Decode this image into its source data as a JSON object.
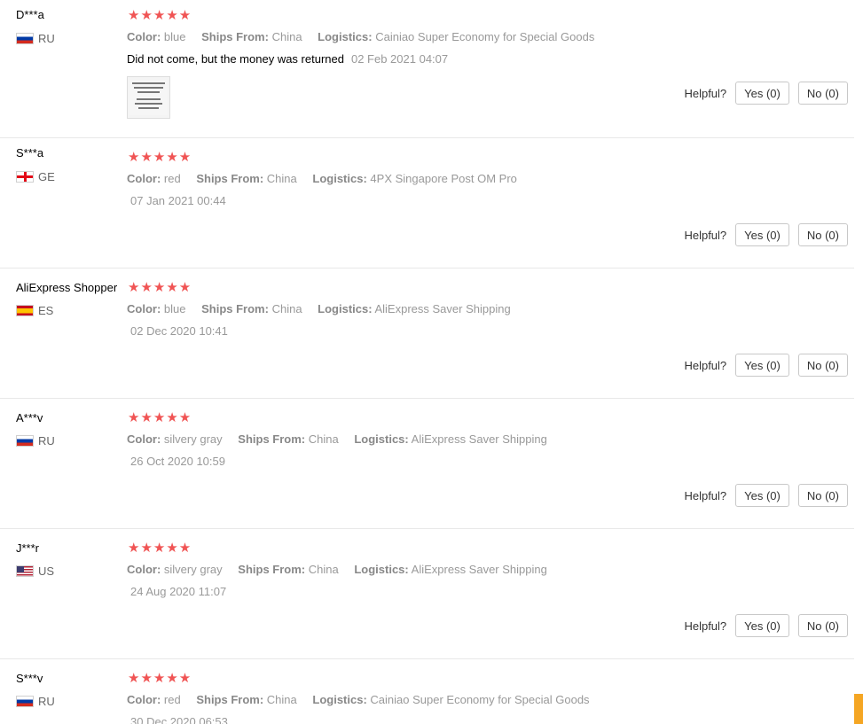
{
  "labels": {
    "color": "Color:",
    "ships_from": "Ships From:",
    "logistics": "Logistics:",
    "helpful": "Helpful?"
  },
  "star_color": "#f05454",
  "reviews": [
    {
      "user": "D***a",
      "country": "RU",
      "flag_icon": "flag-ru-icon",
      "rating": 5,
      "color": "blue",
      "ships_from": "China",
      "logistics": "Cainiao Super Economy for Special Goods",
      "text": "Did not come, but the money was returned",
      "date": "02 Feb 2021 04:07",
      "has_photo": true,
      "yes_label": "Yes (0)",
      "no_label": "No (0)"
    },
    {
      "user": "S***a",
      "country": "GE",
      "flag_icon": "flag-ge-icon",
      "rating": 5,
      "color": "red",
      "ships_from": "China",
      "logistics": "4PX Singapore Post OM Pro",
      "text": "",
      "date": "07 Jan 2021 00:44",
      "yes_label": "Yes (0)",
      "no_label": "No (0)"
    },
    {
      "user": "AliExpress Shopper",
      "country": "ES",
      "flag_icon": "flag-es-icon",
      "rating": 5,
      "color": "blue",
      "ships_from": "China",
      "logistics": "AliExpress Saver Shipping",
      "text": "",
      "date": "02 Dec 2020 10:41",
      "yes_label": "Yes (0)",
      "no_label": "No (0)"
    },
    {
      "user": "A***v",
      "country": "RU",
      "flag_icon": "flag-ru-icon",
      "rating": 5,
      "color": "silvery gray",
      "ships_from": "China",
      "logistics": "AliExpress Saver Shipping",
      "text": "",
      "date": "26 Oct 2020 10:59",
      "yes_label": "Yes (0)",
      "no_label": "No (0)"
    },
    {
      "user": "J***r",
      "country": "US",
      "flag_icon": "flag-us-icon",
      "rating": 5,
      "color": "silvery gray",
      "ships_from": "China",
      "logistics": "AliExpress Saver Shipping",
      "text": "",
      "date": "24 Aug 2020 11:07",
      "yes_label": "Yes (0)",
      "no_label": "No (0)"
    },
    {
      "user": "S***v",
      "country": "RU",
      "flag_icon": "flag-ru-icon",
      "rating": 5,
      "color": "red",
      "ships_from": "China",
      "logistics": "Cainiao Super Economy for Special Goods",
      "text": "",
      "date": "30 Dec 2020 06:53"
    }
  ]
}
